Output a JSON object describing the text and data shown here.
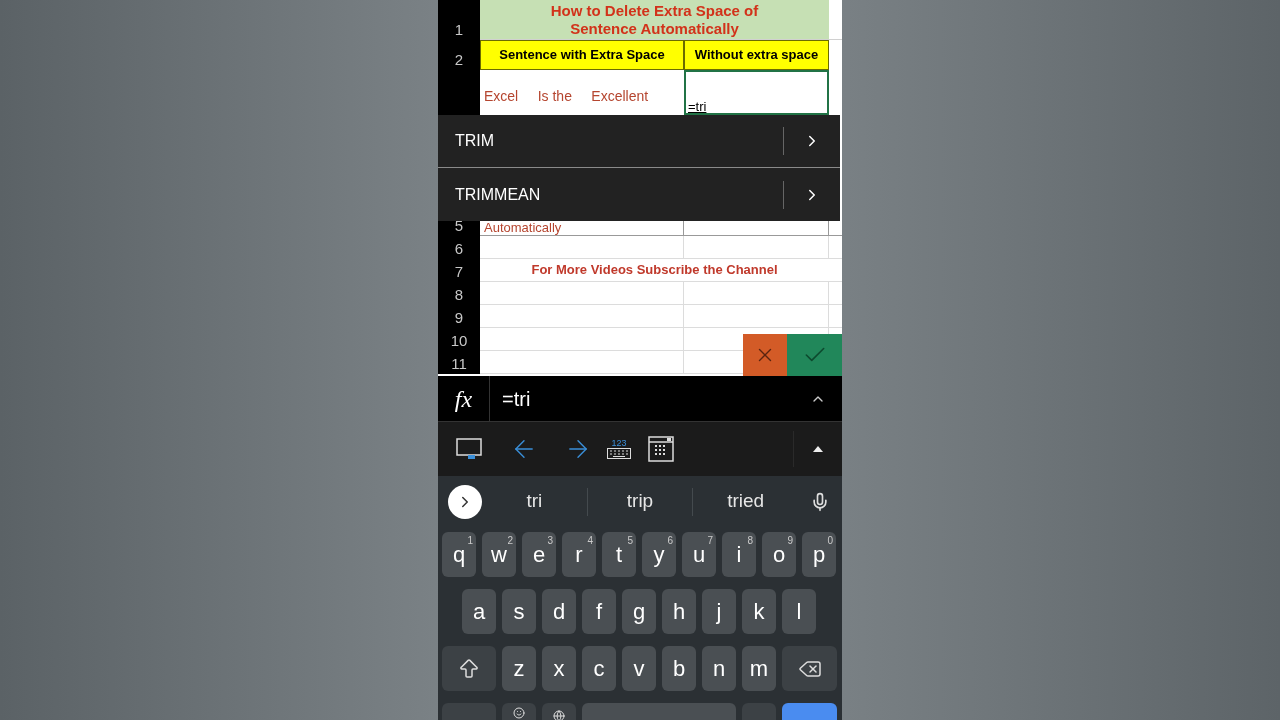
{
  "sheet": {
    "title": [
      "How to Delete Extra Space of",
      "Sentence Automatically"
    ],
    "title_row": "1",
    "header_row": {
      "number": "2",
      "cells": [
        "Sentence with Extra Space",
        "Without extra space"
      ]
    },
    "edit_row": {
      "sentence": "Excel     Is the     Excellent",
      "formula": "=tri"
    },
    "partial_row": {
      "number": "5",
      "text": "Automatically"
    },
    "rows": [
      {
        "number": "6",
        "note": ""
      },
      {
        "number": "7",
        "note": "For More Videos Subscribe the Channel"
      },
      {
        "number": "8",
        "note": ""
      },
      {
        "number": "9",
        "note": ""
      },
      {
        "number": "10",
        "note": ""
      },
      {
        "number": "11",
        "note": ""
      }
    ]
  },
  "autocomplete": [
    "TRIM",
    "TRIMMEAN"
  ],
  "formula_bar": {
    "label": "fx",
    "value": "=tri"
  },
  "toolbar": {
    "keypad_label": "123"
  },
  "suggestions": [
    "tri",
    "trip",
    "tried"
  ],
  "keyboard": {
    "rows": [
      [
        {
          "key": "q",
          "hint": "1"
        },
        {
          "key": "w",
          "hint": "2"
        },
        {
          "key": "e",
          "hint": "3"
        },
        {
          "key": "r",
          "hint": "4"
        },
        {
          "key": "t",
          "hint": "5"
        },
        {
          "key": "y",
          "hint": "6"
        },
        {
          "key": "u",
          "hint": "7"
        },
        {
          "key": "i",
          "hint": "8"
        },
        {
          "key": "o",
          "hint": "9"
        },
        {
          "key": "p",
          "hint": "0"
        }
      ],
      [
        {
          "key": "a"
        },
        {
          "key": "s"
        },
        {
          "key": "d"
        },
        {
          "key": "f"
        },
        {
          "key": "g"
        },
        {
          "key": "h"
        },
        {
          "key": "j"
        },
        {
          "key": "k"
        },
        {
          "key": "l"
        }
      ],
      [
        {
          "key": "z"
        },
        {
          "key": "x"
        },
        {
          "key": "c"
        },
        {
          "key": "v"
        },
        {
          "key": "b"
        },
        {
          "key": "n"
        },
        {
          "key": "m"
        }
      ]
    ]
  }
}
